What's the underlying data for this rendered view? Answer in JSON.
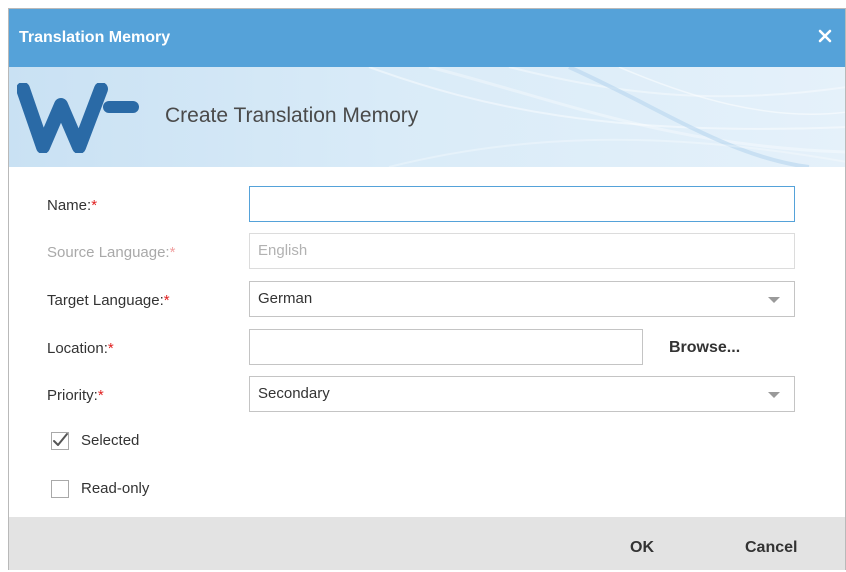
{
  "window": {
    "title": "Translation Memory"
  },
  "banner": {
    "title": "Create Translation Memory"
  },
  "form": {
    "name": {
      "label": "Name:",
      "required_mark": "*",
      "value": ""
    },
    "source_language": {
      "label": "Source Language:",
      "required_mark": "*",
      "value": "English",
      "disabled": true
    },
    "target_language": {
      "label": "Target Language:",
      "required_mark": "*",
      "value": "German"
    },
    "location": {
      "label": "Location:",
      "required_mark": "*",
      "value": "",
      "browse_label": "Browse..."
    },
    "priority": {
      "label": "Priority:",
      "required_mark": "*",
      "value": "Secondary"
    },
    "selected": {
      "label": "Selected",
      "checked": true
    },
    "read_only": {
      "label": "Read-only",
      "checked": false
    }
  },
  "footer": {
    "ok_label": "OK",
    "cancel_label": "Cancel"
  },
  "colors": {
    "titlebar": "#55a2d9",
    "logo": "#2a6aa6",
    "required": "#e02020",
    "focus_border": "#55a2d9"
  },
  "icons": {
    "close": "close-icon",
    "logo": "wf-logo",
    "check": "checkmark-icon",
    "dropdown": "chevron-down-icon"
  }
}
